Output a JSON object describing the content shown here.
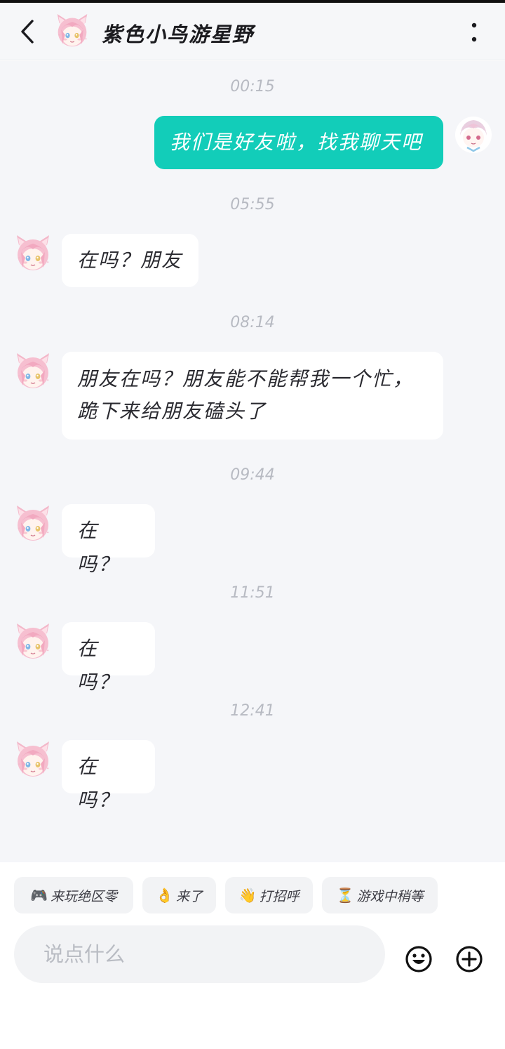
{
  "header": {
    "title": "紫色小鸟游星野"
  },
  "messages": [
    {
      "time": "00:15",
      "sender": "me",
      "text": "我们是好友啦，找我聊天吧"
    },
    {
      "time": "05:55",
      "sender": "friend",
      "text": "在吗？朋友"
    },
    {
      "time": "08:14",
      "sender": "friend",
      "line1": "朋友在吗？朋友能不能帮我一个忙，",
      "line2": "跪下来给朋友磕头了"
    },
    {
      "time": "09:44",
      "sender": "friend",
      "text": "在吗？"
    },
    {
      "time": "11:51",
      "sender": "friend",
      "text": "在吗？"
    },
    {
      "time": "12:41",
      "sender": "friend",
      "text": "在吗？"
    }
  ],
  "quick_replies": [
    {
      "emoji": "🎮",
      "label": "来玩绝区零"
    },
    {
      "emoji": "👌",
      "label": "来了"
    },
    {
      "emoji": "👋",
      "label": "打招呼"
    },
    {
      "emoji": "⏳",
      "label": "游戏中稍等"
    }
  ],
  "composer": {
    "placeholder": "说点什么"
  },
  "icons": {
    "back": "chevron-left-icon",
    "more": "more-vertical-icon",
    "emoji": "emoji-smile-icon",
    "add": "plus-circle-icon"
  },
  "colors": {
    "my_bubble": "#12cdb9",
    "friend_bubble": "#ffffff",
    "chat_background": "#f5f6f9",
    "timestamp": "#b7bac2"
  }
}
